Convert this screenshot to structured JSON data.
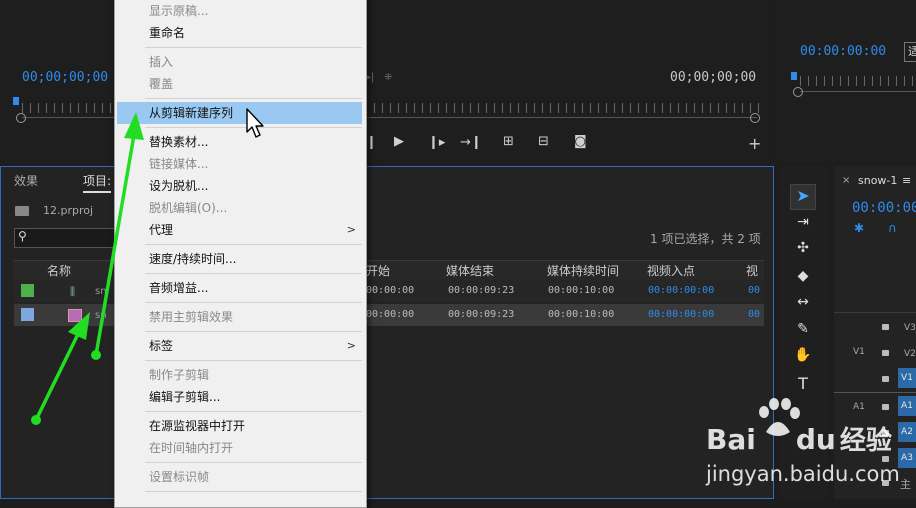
{
  "source_monitor": {
    "timecode_left": "00;00;00;00",
    "timecode_right": "00;00;00;00"
  },
  "program_monitor": {
    "timecode": "00:00:00:00",
    "partial_button": "适"
  },
  "project_panel": {
    "tabs": [
      "效果",
      "项目:"
    ],
    "file": "12.prproj",
    "selection_status": "1 项已选择，共 2 项",
    "columns": [
      "名称",
      "媒体开始",
      "媒体结束",
      "媒体持续时间",
      "视频入点",
      "视"
    ],
    "rows": [
      {
        "color": "#4db04d",
        "name": "sn",
        "start": "00:00:00",
        "end": "00:00:09:23",
        "duration": "00:00:10:00",
        "in": "00:00:00:00",
        "v": "00:0"
      },
      {
        "color": "#7ea7e0",
        "name": "sn",
        "start": "00:00:00",
        "end": "00:00:09:23",
        "duration": "00:00:10:00",
        "in": "00:00:00:00",
        "v": "00:0"
      }
    ]
  },
  "timeline": {
    "tab": "snow-1",
    "timecode": "00:00:00",
    "tracks": [
      {
        "lbl": "",
        "name": "V3"
      },
      {
        "lbl": "V1",
        "name": "V2"
      },
      {
        "lbl": "",
        "name": "V1"
      },
      {
        "lbl": "A1",
        "name": "A1"
      },
      {
        "lbl": "",
        "name": "A2"
      },
      {
        "lbl": "",
        "name": "A3"
      },
      {
        "lbl": "",
        "name": "主"
      }
    ]
  },
  "context_menu": {
    "items": [
      {
        "label": "显示原稿...",
        "disabled": true
      },
      {
        "label": "重命名",
        "disabled": false
      },
      {
        "label": "插入",
        "disabled": true
      },
      {
        "label": "覆盖",
        "disabled": true
      },
      {
        "label": "从剪辑新建序列",
        "disabled": false,
        "highlighted": true
      },
      {
        "label": "替换素材...",
        "disabled": false
      },
      {
        "label": "链接媒体...",
        "disabled": true
      },
      {
        "label": "设为脱机...",
        "disabled": false
      },
      {
        "label": "脱机编辑(O)...",
        "disabled": true
      },
      {
        "label": "代理",
        "disabled": false,
        "submenu": true
      },
      {
        "label": "速度/持续时间...",
        "disabled": false
      },
      {
        "label": "音频增益...",
        "disabled": false
      },
      {
        "label": "禁用主剪辑效果",
        "disabled": true
      },
      {
        "label": "标签",
        "disabled": false,
        "submenu": true
      },
      {
        "label": "制作子剪辑",
        "disabled": true
      },
      {
        "label": "编辑子剪辑...",
        "disabled": false
      },
      {
        "label": "在源监视器中打开",
        "disabled": false
      },
      {
        "label": "在时间轴内打开",
        "disabled": true
      },
      {
        "label": "设置标识帧",
        "disabled": true
      }
    ]
  },
  "watermark": {
    "brand_a": "Bai",
    "brand_b": "du",
    "brand_c": "经验",
    "url": "jingyan.baidu.com"
  },
  "colors": {
    "accent_blue": "#2d8ceb",
    "menu_highlight": "#99c9f1",
    "annotation_arrow": "#22dd22"
  }
}
